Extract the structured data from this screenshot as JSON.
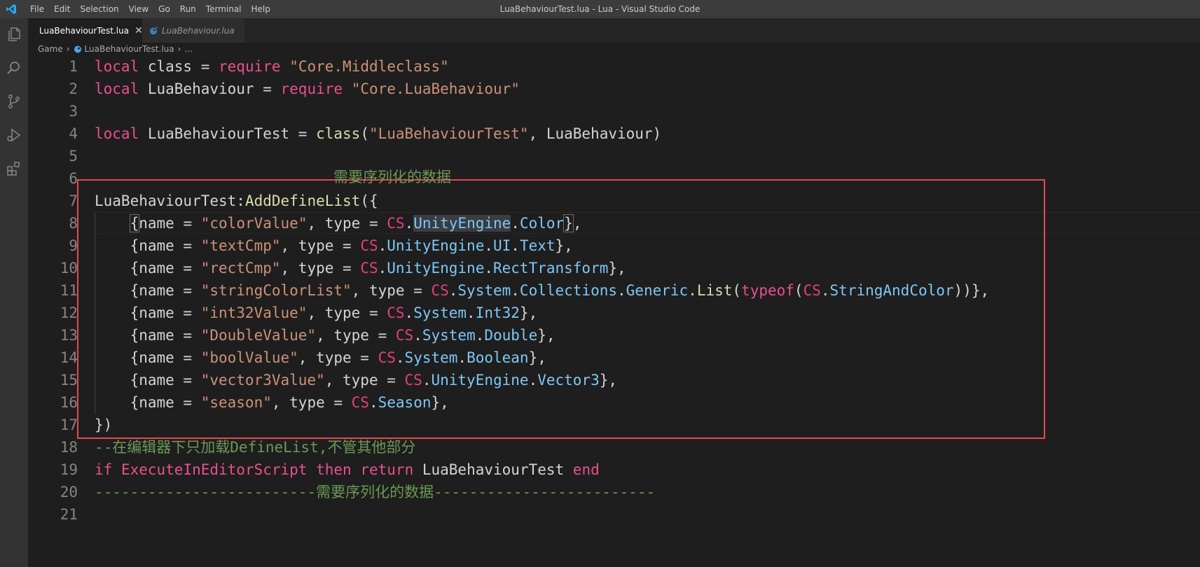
{
  "titlebar": {
    "menu": [
      "File",
      "Edit",
      "Selection",
      "View",
      "Go",
      "Run",
      "Terminal",
      "Help"
    ],
    "window_title": "LuaBehaviourTest.lua - Lua - Visual Studio Code"
  },
  "activity_icons": [
    "explorer-icon",
    "search-icon",
    "source-control-icon",
    "run-debug-icon",
    "extensions-icon"
  ],
  "tabs": [
    {
      "label": "LuaBehaviourTest.lua",
      "active": true
    },
    {
      "label": "LuaBehaviour.lua",
      "active": false
    }
  ],
  "breadcrumb": {
    "folder": "Game",
    "file": "LuaBehaviourTest.lua",
    "symbol": "..."
  },
  "colors": {
    "annotation_border": "#e8484f",
    "comment": "#6a9955",
    "keyword": "#ec4f8e"
  },
  "annotation": {
    "text": "需要序列化的数据"
  },
  "editor": {
    "line_numbers": [
      "1",
      "2",
      "3",
      "4",
      "5",
      "6",
      "7",
      "8",
      "9",
      "10",
      "11",
      "12",
      "13",
      "14",
      "15",
      "16",
      "17",
      "18",
      "19",
      "20",
      "21"
    ],
    "lines": [
      {
        "tokens": [
          {
            "t": "local",
            "c": "kw"
          },
          {
            "t": " class = ",
            "c": "id"
          },
          {
            "t": "require",
            "c": "kw"
          },
          {
            "t": " ",
            "c": "id"
          },
          {
            "t": "\"Core.Middleclass\"",
            "c": "str"
          }
        ]
      },
      {
        "tokens": [
          {
            "t": "local",
            "c": "kw"
          },
          {
            "t": " LuaBehaviour = ",
            "c": "id"
          },
          {
            "t": "require",
            "c": "kw"
          },
          {
            "t": " ",
            "c": "id"
          },
          {
            "t": "\"Core.LuaBehaviour\"",
            "c": "str"
          }
        ]
      },
      {
        "tokens": []
      },
      {
        "tokens": [
          {
            "t": "local",
            "c": "kw"
          },
          {
            "t": " LuaBehaviourTest = ",
            "c": "id"
          },
          {
            "t": "class",
            "c": "fn"
          },
          {
            "t": "(",
            "c": "id"
          },
          {
            "t": "\"LuaBehaviourTest\"",
            "c": "str"
          },
          {
            "t": ", LuaBehaviour)",
            "c": "id"
          }
        ]
      },
      {
        "tokens": []
      },
      {
        "tokens": []
      },
      {
        "tokens": [
          {
            "t": "LuaBehaviourTest:",
            "c": "id"
          },
          {
            "t": "AddDefineList",
            "c": "fn"
          },
          {
            "t": "({",
            "c": "id"
          }
        ]
      },
      {
        "tokens": [
          {
            "t": "    ",
            "c": "id"
          },
          {
            "t": "{",
            "c": "br"
          },
          {
            "t": "name = ",
            "c": "id"
          },
          {
            "t": "\"colorValue\"",
            "c": "str"
          },
          {
            "t": ", type = ",
            "c": "id"
          },
          {
            "t": "CS",
            "c": "cs"
          },
          {
            "t": ".",
            "c": "id"
          },
          {
            "t": "UnityEngine",
            "c": "type hl"
          },
          {
            "t": ".",
            "c": "id"
          },
          {
            "t": "Color",
            "c": "type"
          },
          {
            "t": "}",
            "c": "br"
          },
          {
            "t": ",",
            "c": "id"
          }
        ]
      },
      {
        "tokens": [
          {
            "t": "    {name = ",
            "c": "id"
          },
          {
            "t": "\"textCmp\"",
            "c": "str"
          },
          {
            "t": ", type = ",
            "c": "id"
          },
          {
            "t": "CS",
            "c": "cs"
          },
          {
            "t": ".",
            "c": "id"
          },
          {
            "t": "UnityEngine",
            "c": "type"
          },
          {
            "t": ".",
            "c": "id"
          },
          {
            "t": "UI",
            "c": "type"
          },
          {
            "t": ".",
            "c": "id"
          },
          {
            "t": "Text",
            "c": "type"
          },
          {
            "t": "},",
            "c": "id"
          }
        ]
      },
      {
        "tokens": [
          {
            "t": "    {name = ",
            "c": "id"
          },
          {
            "t": "\"rectCmp\"",
            "c": "str"
          },
          {
            "t": ", type = ",
            "c": "id"
          },
          {
            "t": "CS",
            "c": "cs"
          },
          {
            "t": ".",
            "c": "id"
          },
          {
            "t": "UnityEngine",
            "c": "type"
          },
          {
            "t": ".",
            "c": "id"
          },
          {
            "t": "RectTransform",
            "c": "type"
          },
          {
            "t": "},",
            "c": "id"
          }
        ]
      },
      {
        "tokens": [
          {
            "t": "    {name = ",
            "c": "id"
          },
          {
            "t": "\"stringColorList\"",
            "c": "str"
          },
          {
            "t": ", type = ",
            "c": "id"
          },
          {
            "t": "CS",
            "c": "cs"
          },
          {
            "t": ".",
            "c": "id"
          },
          {
            "t": "System",
            "c": "type"
          },
          {
            "t": ".",
            "c": "id"
          },
          {
            "t": "Collections",
            "c": "type"
          },
          {
            "t": ".",
            "c": "id"
          },
          {
            "t": "Generic",
            "c": "type"
          },
          {
            "t": ".",
            "c": "id"
          },
          {
            "t": "List",
            "c": "fn"
          },
          {
            "t": "(",
            "c": "id"
          },
          {
            "t": "typeof",
            "c": "kw"
          },
          {
            "t": "(",
            "c": "id"
          },
          {
            "t": "CS",
            "c": "cs"
          },
          {
            "t": ".",
            "c": "id"
          },
          {
            "t": "StringAndColor",
            "c": "type"
          },
          {
            "t": "))},",
            "c": "id"
          }
        ]
      },
      {
        "tokens": [
          {
            "t": "    {name = ",
            "c": "id"
          },
          {
            "t": "\"int32Value\"",
            "c": "str"
          },
          {
            "t": ", type = ",
            "c": "id"
          },
          {
            "t": "CS",
            "c": "cs"
          },
          {
            "t": ".",
            "c": "id"
          },
          {
            "t": "System",
            "c": "type"
          },
          {
            "t": ".",
            "c": "id"
          },
          {
            "t": "Int32",
            "c": "type"
          },
          {
            "t": "},",
            "c": "id"
          }
        ]
      },
      {
        "tokens": [
          {
            "t": "    {name = ",
            "c": "id"
          },
          {
            "t": "\"DoubleValue\"",
            "c": "str"
          },
          {
            "t": ", type = ",
            "c": "id"
          },
          {
            "t": "CS",
            "c": "cs"
          },
          {
            "t": ".",
            "c": "id"
          },
          {
            "t": "System",
            "c": "type"
          },
          {
            "t": ".",
            "c": "id"
          },
          {
            "t": "Double",
            "c": "type"
          },
          {
            "t": "},",
            "c": "id"
          }
        ]
      },
      {
        "tokens": [
          {
            "t": "    {name = ",
            "c": "id"
          },
          {
            "t": "\"boolValue\"",
            "c": "str"
          },
          {
            "t": ", type = ",
            "c": "id"
          },
          {
            "t": "CS",
            "c": "cs"
          },
          {
            "t": ".",
            "c": "id"
          },
          {
            "t": "System",
            "c": "type"
          },
          {
            "t": ".",
            "c": "id"
          },
          {
            "t": "Boolean",
            "c": "type"
          },
          {
            "t": "},",
            "c": "id"
          }
        ]
      },
      {
        "tokens": [
          {
            "t": "    {name = ",
            "c": "id"
          },
          {
            "t": "\"vector3Value\"",
            "c": "str"
          },
          {
            "t": ", type = ",
            "c": "id"
          },
          {
            "t": "CS",
            "c": "cs"
          },
          {
            "t": ".",
            "c": "id"
          },
          {
            "t": "UnityEngine",
            "c": "type"
          },
          {
            "t": ".",
            "c": "id"
          },
          {
            "t": "Vector3",
            "c": "type"
          },
          {
            "t": "},",
            "c": "id"
          }
        ]
      },
      {
        "tokens": [
          {
            "t": "    {name = ",
            "c": "id"
          },
          {
            "t": "\"season\"",
            "c": "str"
          },
          {
            "t": ", type = ",
            "c": "id"
          },
          {
            "t": "CS",
            "c": "cs"
          },
          {
            "t": ".",
            "c": "id"
          },
          {
            "t": "Season",
            "c": "type"
          },
          {
            "t": "},",
            "c": "id"
          }
        ]
      },
      {
        "tokens": [
          {
            "t": "})",
            "c": "id"
          }
        ]
      },
      {
        "tokens": [
          {
            "t": "--在编辑器下只加载DefineList,不管其他部分",
            "c": "cmt"
          }
        ]
      },
      {
        "tokens": [
          {
            "t": "if",
            "c": "kw"
          },
          {
            "t": " ",
            "c": "id"
          },
          {
            "t": "ExecuteInEditorScript",
            "c": "kw"
          },
          {
            "t": " ",
            "c": "id"
          },
          {
            "t": "then",
            "c": "kw"
          },
          {
            "t": " ",
            "c": "id"
          },
          {
            "t": "return",
            "c": "kw"
          },
          {
            "t": " LuaBehaviourTest ",
            "c": "id"
          },
          {
            "t": "end",
            "c": "kw"
          }
        ]
      },
      {
        "tokens": [
          {
            "t": "-------------------------需要序列化的数据-------------------------",
            "c": "cmt"
          }
        ]
      },
      {
        "tokens": []
      }
    ]
  }
}
